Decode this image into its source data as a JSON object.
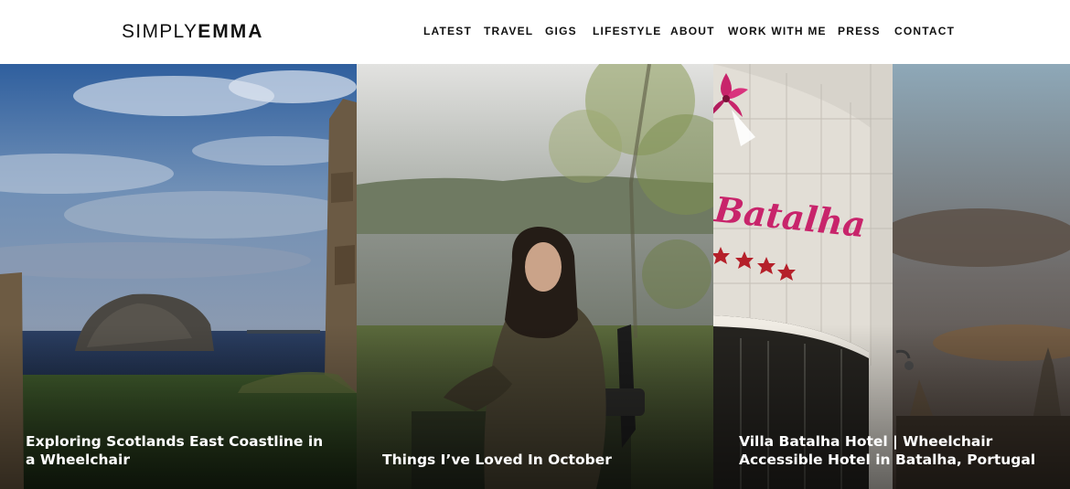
{
  "logo": {
    "light": "SIMPLY",
    "bold": "EMMA"
  },
  "nav": {
    "items": [
      {
        "label": "LATEST"
      },
      {
        "label": "TRAVEL"
      },
      {
        "label": "GIGS"
      },
      {
        "label": "LIFESTYLE"
      },
      {
        "label": "ABOUT"
      },
      {
        "label": "WORK WITH ME"
      },
      {
        "label": "PRESS"
      },
      {
        "label": "CONTACT"
      }
    ]
  },
  "posts": [
    {
      "title": "Exploring Scotlands East Coastline in a Wheelchair"
    },
    {
      "title": "Things I’ve Loved In October"
    },
    {
      "title": "Villa Batalha Hotel | Wheelchair Accessible Hotel in Batalha, Portugal"
    }
  ],
  "hotel_sign": {
    "text": "Batalha"
  },
  "colors": {
    "header_bg": "#ffffff",
    "nav_text": "#111111",
    "title_text": "#ffffff",
    "sky_blue": "#3d6aa0",
    "sign_pink": "#c8246b"
  }
}
